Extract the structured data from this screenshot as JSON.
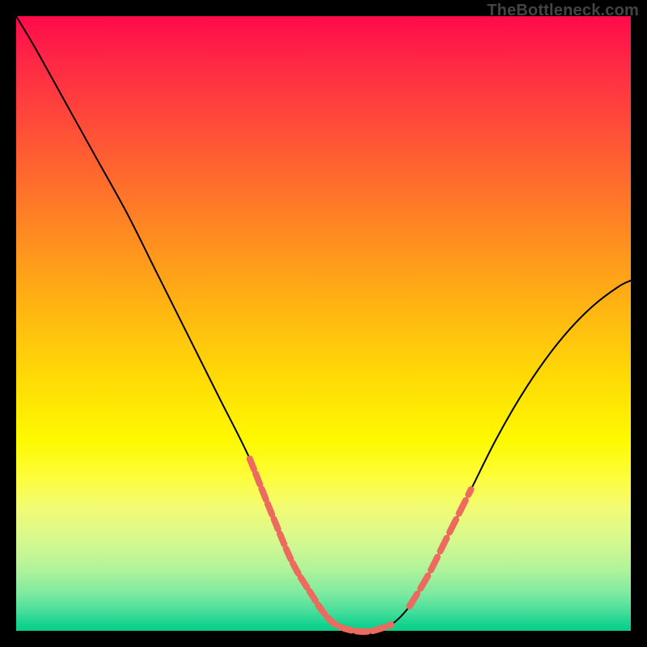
{
  "watermark": "TheBottleneck.com",
  "colors": {
    "background": "#000000",
    "curve": "#000000",
    "dash": "#ec6b5e",
    "gradient_top": "#ff0a4a",
    "gradient_bottom": "#0acd88"
  },
  "chart_data": {
    "type": "line",
    "title": "",
    "xlabel": "",
    "ylabel": "",
    "xlim": [
      0,
      100
    ],
    "ylim": [
      0,
      100
    ],
    "series": [
      {
        "name": "bottleneck-curve",
        "x": [
          0,
          3,
          8,
          13,
          18,
          23,
          28,
          33,
          38,
          42,
          45,
          48,
          50,
          52,
          55,
          58,
          61,
          64,
          67,
          70,
          74,
          78,
          82,
          86,
          90,
          94,
          98,
          100
        ],
        "y": [
          100,
          95,
          86,
          77,
          68,
          58,
          48,
          38,
          28,
          18,
          11,
          6,
          3,
          1,
          0,
          0,
          1,
          4,
          9,
          15,
          23,
          31,
          38,
          44,
          49,
          53,
          56,
          57
        ]
      }
    ],
    "annotations": {
      "dashed_segments": [
        {
          "name": "left-hint",
          "dash_pattern": "14 6",
          "x": [
            38,
            42,
            45,
            48,
            50,
            52,
            55,
            58,
            61
          ],
          "y": [
            28,
            18,
            11,
            6,
            3,
            1,
            0,
            0,
            1
          ]
        },
        {
          "name": "right-hint",
          "dash_pattern": "18 8",
          "x": [
            64,
            67,
            70,
            74
          ],
          "y": [
            4,
            9,
            15,
            23
          ]
        }
      ]
    }
  }
}
